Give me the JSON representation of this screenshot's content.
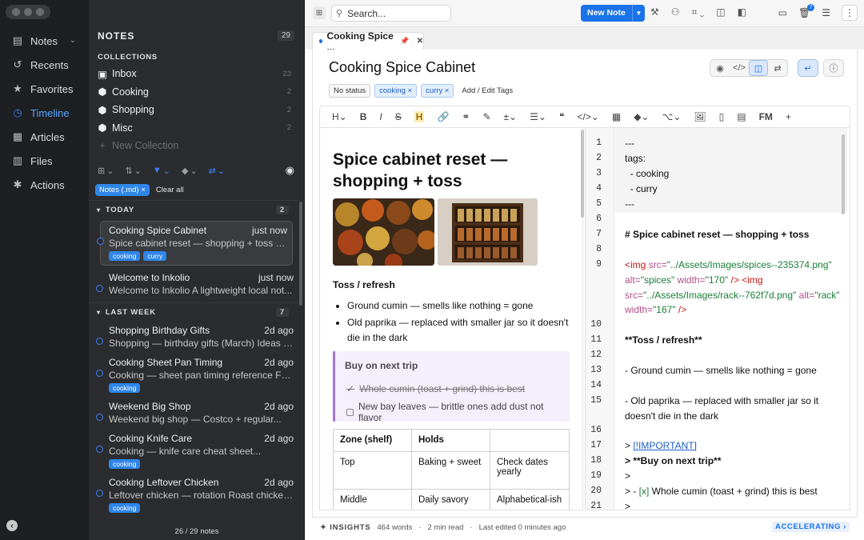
{
  "sidebar": {
    "items": [
      {
        "label": "Notes",
        "icon": "document-icon",
        "has_chevron": true
      },
      {
        "label": "Recents",
        "icon": "history-icon"
      },
      {
        "label": "Favorites",
        "icon": "star-icon"
      },
      {
        "label": "Timeline",
        "icon": "clock-icon",
        "active": true
      },
      {
        "label": "Articles",
        "icon": "articles-icon"
      },
      {
        "label": "Files",
        "icon": "files-icon"
      },
      {
        "label": "Actions",
        "icon": "sparkle-icon"
      }
    ]
  },
  "notes_panel": {
    "title": "NOTES",
    "count": "29",
    "collections_title": "COLLECTIONS",
    "collections": [
      {
        "label": "Inbox",
        "count": "23",
        "icon": "inbox-icon"
      },
      {
        "label": "Cooking",
        "count": "2",
        "icon": "cube-icon"
      },
      {
        "label": "Shopping",
        "count": "2",
        "icon": "cube-icon"
      },
      {
        "label": "Misc",
        "count": "2",
        "icon": "cube-icon"
      }
    ],
    "new_collection": "New Collection",
    "filter_chip": "Notes (.md)",
    "clear_all": "Clear all",
    "sections": [
      {
        "label": "TODAY",
        "count": "2"
      },
      {
        "label": "LAST WEEK",
        "count": "7"
      }
    ],
    "today_notes": [
      {
        "title": "Cooking Spice Cabinet",
        "time": "just now",
        "snippet": "Spice cabinet reset — shopping + toss <im...",
        "tags": [
          "cooking",
          "curry"
        ],
        "selected": true
      },
      {
        "title": "Welcome to Inkolio",
        "time": "just now",
        "snippet": "Welcome to Inkolio A lightweight local not...",
        "tags": []
      }
    ],
    "week_notes": [
      {
        "title": "Shopping Birthday Gifts",
        "time": "2d ago",
        "snippet": "Shopping — birthday gifts (March) Ideas s...",
        "tags": []
      },
      {
        "title": "Cooking Sheet Pan Timing",
        "time": "2d ago",
        "snippet": "Cooking — sheet pan timing reference Fro...",
        "tags": [
          "cooking"
        ]
      },
      {
        "title": "Weekend Big Shop",
        "time": "2d ago",
        "snippet": "Weekend big shop — Costco + regular...",
        "tags": []
      },
      {
        "title": "Cooking Knife Care",
        "time": "2d ago",
        "snippet": "Cooking — knife care cheat sheet...",
        "tags": [
          "cooking"
        ]
      },
      {
        "title": "Cooking Leftover Chicken",
        "time": "2d ago",
        "snippet": "Leftover chicken — rotation Roast chicken...",
        "tags": [
          "cooking"
        ]
      }
    ],
    "footer": "26 / 29 notes"
  },
  "topbar": {
    "search_placeholder": "Search...",
    "new_note": "New Note",
    "trash_badge": "7"
  },
  "tab": {
    "label": "Cooking Spice ..."
  },
  "note": {
    "title": "Cooking Spice Cabinet",
    "status": "No status",
    "tags": [
      "cooking",
      "curry"
    ],
    "add_tags": "Add / Edit Tags",
    "format_labels": {
      "heading": "H",
      "bold": "B",
      "italic": "I",
      "strike": "S",
      "highlight": "H",
      "code": "</>",
      "frontmatter": "FM",
      "add": "+"
    }
  },
  "preview": {
    "heading": "Spice cabinet reset — shopping + toss",
    "subheading": "Toss / refresh",
    "bullets": [
      "Ground cumin — smells like nothing = gone",
      "Old paprika — replaced with smaller jar so it doesn't die in the dark"
    ],
    "callout_title": "Buy on next trip",
    "callout_items": [
      {
        "text": "Whole cumin (toast + grind) this is best",
        "done": true
      },
      {
        "text": "New bay leaves — brittle ones add dust not flavor",
        "done": false
      }
    ],
    "table": {
      "headers": [
        "Zone (shelf)",
        "Holds",
        ""
      ],
      "rows": [
        [
          "Top",
          "Baking + sweet",
          "Check dates yearly"
        ],
        [
          "Middle",
          "Daily savory",
          "Alphabetical-ish"
        ]
      ]
    }
  },
  "source": {
    "line_numbers": [
      "1",
      "2",
      "3",
      "4",
      "5",
      "6",
      "7",
      "8",
      "9",
      "10",
      "11",
      "12",
      "13",
      "14",
      "15",
      "16",
      "17",
      "18",
      "19",
      "20",
      "21"
    ],
    "l1": "---",
    "l2": "tags:",
    "l3": "  - cooking",
    "l4": "  - curry",
    "l5": "---",
    "l7": "# Spice cabinet reset — shopping + toss",
    "l9_tag1": "<img",
    "l9_attr1": "src=",
    "l9_str1": "\"../Assets/Images/spices--235374.png\"",
    "l9_attr2": "alt=",
    "l9_str2": "\"spices\"",
    "l9_attr3": "width=",
    "l9_str3": "\"170\"",
    "l9_close1": "/>",
    "l9_tag2": "<img",
    "l9_attr4": "src=",
    "l9_str4": "\"../Assets/Images/rack--762f7d.png\"",
    "l9_attr5": "alt=",
    "l9_str5": "\"rack\"",
    "l9_attr6": "width=",
    "l9_str6": "\"167\"",
    "l9_close2": "/>",
    "l11": "**Toss / refresh**",
    "l13": "- Ground cumin — smells like nothing = gone",
    "l15": "- Old paprika — replaced with smaller jar so it doesn't die in the dark",
    "l17_pre": "> ",
    "l17_link": "[!IMPORTANT]",
    "l18": "> **Buy on next trip**",
    "l19": ">",
    "l20_pre": "> - ",
    "l20_ck": "[x]",
    "l20_txt": " Whole cumin (toast + grind) this is best",
    "l21": ">"
  },
  "footer": {
    "insights": "INSIGHTS",
    "words": "464 words",
    "read": "2 min read",
    "edited": "Last edited 0 minutes ago",
    "accel": "ACCELERATING"
  }
}
